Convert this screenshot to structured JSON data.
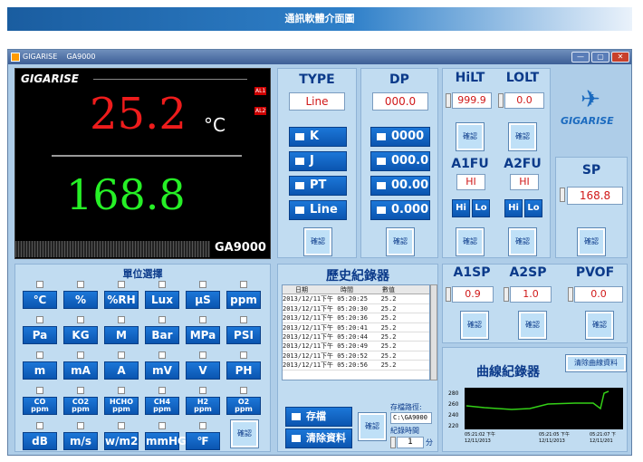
{
  "banner": "通訊軟體介面圖",
  "window": {
    "title": "GIGARISE    GA9000",
    "min": "—",
    "max": "▢",
    "close": "✕"
  },
  "display": {
    "logo": "GIGARISE",
    "pv": "25.2",
    "unit": "°C",
    "sv": "168.8",
    "al1": "AL1",
    "al2": "AL2",
    "model": "GA9000"
  },
  "type": {
    "header": "TYPE",
    "value": "Line",
    "options": [
      "K",
      "J",
      "PT",
      "Line"
    ],
    "ok": "確認"
  },
  "dp": {
    "header": "DP",
    "value": "000.0",
    "options": [
      "0000",
      "000.0",
      "00.00",
      "0.000"
    ],
    "ok": "確認"
  },
  "hilt": {
    "header": "HiLT",
    "value": "999.9",
    "ok": "確認"
  },
  "lolt": {
    "header": "LOLT",
    "value": "0.0",
    "ok": "確認"
  },
  "a1fu": {
    "header": "A1FU",
    "value": "HI",
    "hi": "Hi",
    "lo": "Lo",
    "ok": "確認"
  },
  "a2fu": {
    "header": "A2FU",
    "value": "HI",
    "hi": "Hi",
    "lo": "Lo",
    "ok": "確認"
  },
  "brand": "GIGARISE",
  "sp": {
    "header": "SP",
    "value": "168.8",
    "ok": "確認"
  },
  "units": {
    "header": "單位選擇",
    "rows": [
      [
        "℃",
        "%",
        "%RH",
        "Lux",
        "μS",
        "ppm"
      ],
      [
        "Pa",
        "KG",
        "M",
        "Bar",
        "MPa",
        "PSI"
      ],
      [
        "m",
        "mA",
        "A",
        "mV",
        "V",
        "PH"
      ],
      [
        "CO ppm",
        "CO2 ppm",
        "HCHO ppm",
        "CH4 ppm",
        "H2 ppm",
        "O2 ppm"
      ],
      [
        "dB",
        "m/s",
        "w/m2",
        "mmHG",
        "℉"
      ]
    ],
    "ok": "確認"
  },
  "history": {
    "header": "歷史紀錄器",
    "cols": [
      "日期",
      "時間",
      "數值"
    ],
    "rows": [
      [
        "2013/12/11",
        "下午 05:20:25",
        "25.2"
      ],
      [
        "2013/12/11",
        "下午 05:20:30",
        "25.2"
      ],
      [
        "2013/12/11",
        "下午 05:20:36",
        "25.2"
      ],
      [
        "2013/12/11",
        "下午 05:20:41",
        "25.2"
      ],
      [
        "2013/12/11",
        "下午 05:20:44",
        "25.2"
      ],
      [
        "2013/12/11",
        "下午 05:20:49",
        "25.2"
      ],
      [
        "2013/12/11",
        "下午 05:20:52",
        "25.2"
      ],
      [
        "2013/12/11",
        "下午 05:20:56",
        "25.2"
      ]
    ],
    "save": "存檔",
    "clear": "清除資料",
    "ok": "確認",
    "path_label": "存檔路徑:",
    "path": "C:\\GA9000",
    "interval_label": "紀錄時間",
    "interval": "1",
    "interval_unit": "分"
  },
  "a1sp": {
    "header": "A1SP",
    "value": "0.9",
    "ok": "確認"
  },
  "a2sp": {
    "header": "A2SP",
    "value": "1.0",
    "ok": "確認"
  },
  "pvof": {
    "header": "PVOF",
    "value": "0.0",
    "ok": "確認"
  },
  "curve": {
    "header": "曲線紀錄器",
    "clear": "清除曲線資料",
    "yticks": [
      "280",
      "260",
      "240",
      "220"
    ],
    "xticks": [
      [
        "05:21:02 下午",
        "12/11/2013"
      ],
      [
        "05:21:05 下午",
        "12/11/2013"
      ],
      [
        "05:21:07 下",
        "12/11/201"
      ]
    ],
    "colors": {
      "line": "#34d017",
      "bg": "#000000"
    }
  }
}
